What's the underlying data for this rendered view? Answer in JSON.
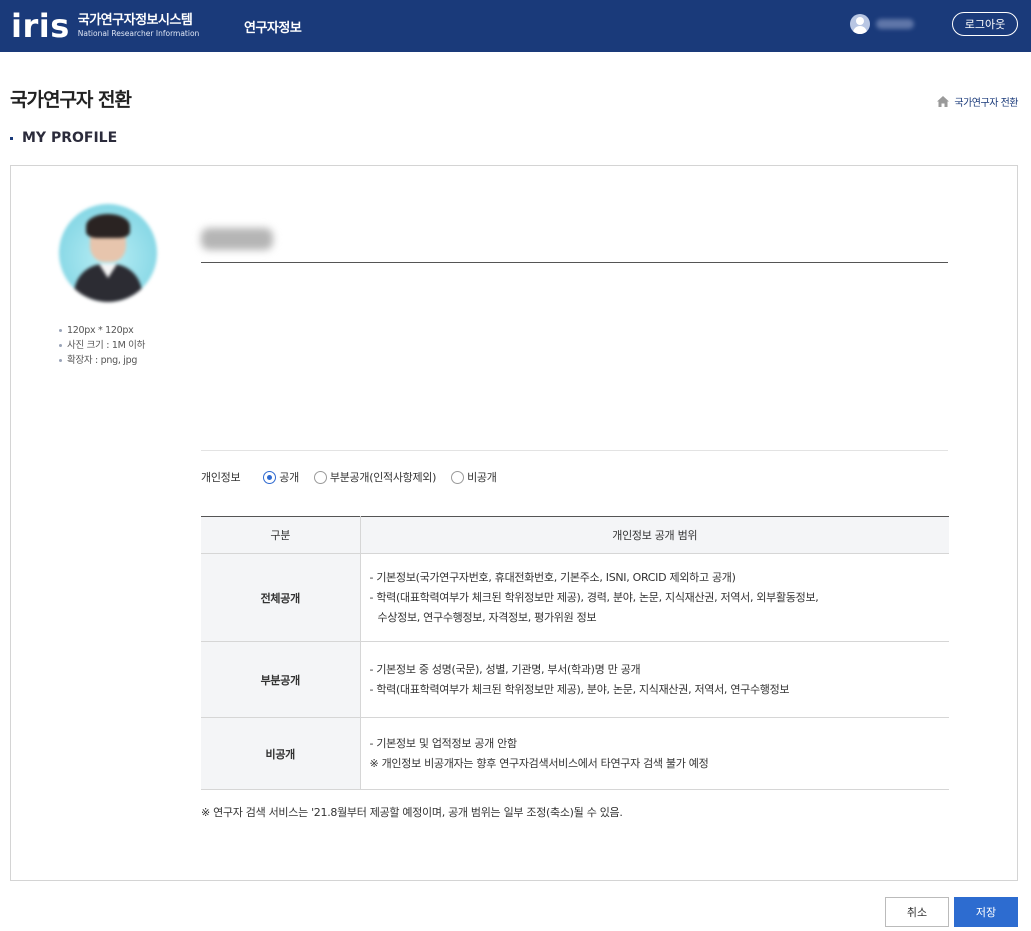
{
  "header": {
    "logo_text": "iris",
    "logo_title": "국가연구자정보시스템",
    "logo_subtitle": "National Researcher Information",
    "nav_title": "연구자정보",
    "logout_label": "로그아웃",
    "bg_color": "#1a3a7a"
  },
  "page": {
    "title": "국가연구자 전환",
    "breadcrumb": "국가연구자 전환",
    "section_title": "MY PROFILE"
  },
  "profile": {
    "photo_notes": [
      "120px * 120px",
      "사진 크기 : 1M 이하",
      "확장자 : png, jpg"
    ]
  },
  "privacy": {
    "label": "개인정보",
    "options": [
      {
        "label": "공개",
        "selected": true
      },
      {
        "label": "부분공개(인적사항제외)",
        "selected": false
      },
      {
        "label": "비공개",
        "selected": false
      }
    ]
  },
  "scope_table": {
    "headers": [
      "구분",
      "개인정보 공개 범위"
    ],
    "rows": [
      {
        "category": "전체공개",
        "lines": [
          "- 기본정보(국가연구자번호, 휴대전화번호, 기본주소, ISNI, ORCID 제외하고 공개)",
          "- 학력(대표학력여부가 체크된 학위정보만 제공), 경력, 분야, 논문, 지식재산권, 저역서, 외부활동정보,",
          "수상정보, 연구수행정보, 자격정보, 평가위원 정보"
        ]
      },
      {
        "category": "부분공개",
        "lines": [
          "- 기본정보 중 성명(국문), 성별, 기관명, 부서(학과)명 만 공개",
          "- 학력(대표학력여부가 체크된 학위정보만 제공), 분야, 논문, 지식재산권, 저역서, 연구수행정보"
        ]
      },
      {
        "category": "비공개",
        "lines": [
          "- 기본정보 및 업적정보 공개 안함",
          "※ 개인정보 비공개자는 향후 연구자검색서비스에서 타연구자 검색 불가 예정"
        ]
      }
    ]
  },
  "footnote": "※ 연구자 검색 서비스는 '21.8월부터 제공할 예정이며, 공개 범위는 일부 조정(축소)될 수 있음.",
  "buttons": {
    "cancel": "취소",
    "save": "저장"
  },
  "colors": {
    "accent": "#2d6cd0",
    "header": "#1a3a7a"
  }
}
